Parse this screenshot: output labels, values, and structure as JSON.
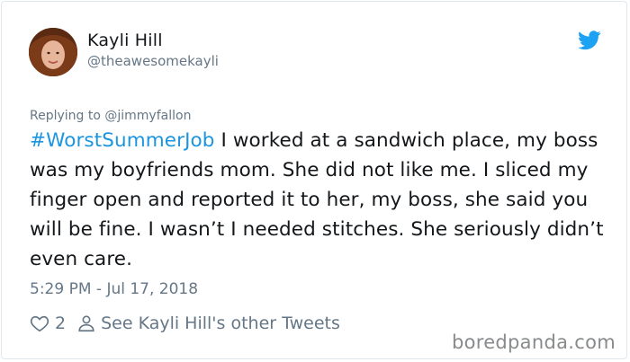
{
  "user": {
    "name": "Kayli Hill",
    "handle": "@theawesomekayli"
  },
  "reply": {
    "text": "Replying to @jimmyfallon"
  },
  "tweet": {
    "hashtag": "#WorstSummerJob",
    "body": " I worked at a sandwich place, my boss was my boyfriends mom. She did not like me. I sliced my finger open and reported it to her, my boss, she said you will be fine. I wasn’t I needed stitches. She seriously didn’t even care."
  },
  "timestamp": "5:29 PM - Jul 17, 2018",
  "actions": {
    "like_count": "2",
    "other_tweets": "See Kayli Hill's other Tweets"
  },
  "icons": {
    "brand": "twitter-bird-icon",
    "like": "heart-icon",
    "profile": "person-icon"
  },
  "colors": {
    "twitter_blue": "#1da1f2",
    "hashtag": "#1b95e0",
    "muted": "#657786"
  },
  "watermark": "boredpanda.com"
}
